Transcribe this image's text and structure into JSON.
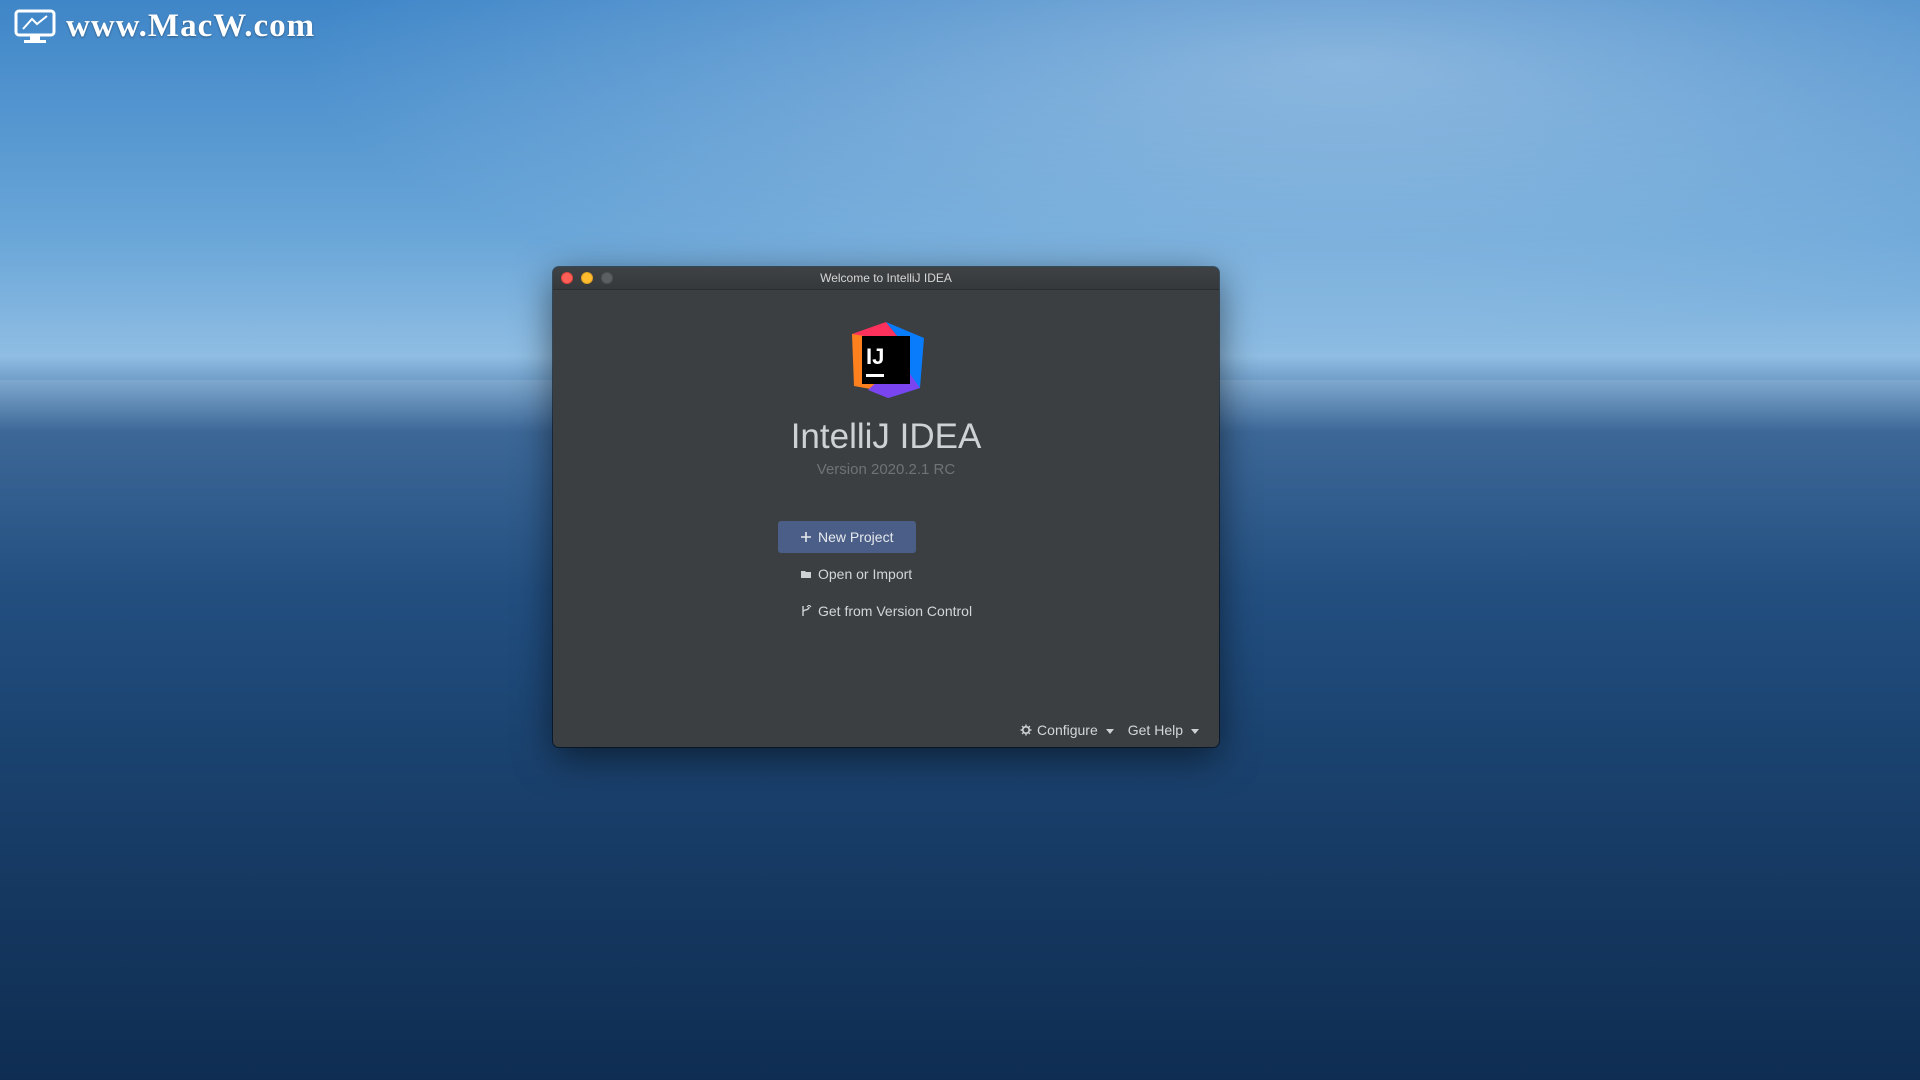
{
  "desktop": {
    "watermark": {
      "text": "www.MacW.com"
    }
  },
  "window": {
    "title": "Welcome to IntelliJ IDEA",
    "traffic_lights": {
      "close": "#ff5f57",
      "minimize": "#febc2e",
      "zoom": "#5c5f62"
    }
  },
  "welcome": {
    "logo_text": "IJ",
    "app_name": "IntelliJ IDEA",
    "version": "Version 2020.2.1 RC",
    "actions": {
      "new_project": "New Project",
      "open_or_import": "Open or Import",
      "get_from_vcs": "Get from Version Control"
    },
    "footer": {
      "configure": "Configure",
      "get_help": "Get Help"
    }
  },
  "colors": {
    "window_bg": "#3c3f41",
    "primary_button": "#4a5e87",
    "text_primary": "#d3d6d8",
    "text_muted": "#6f7376"
  },
  "icons": {
    "new_project": "plus-icon",
    "open_or_import": "folder-icon",
    "get_from_vcs": "vcs-branch-icon",
    "configure": "gear-icon"
  }
}
